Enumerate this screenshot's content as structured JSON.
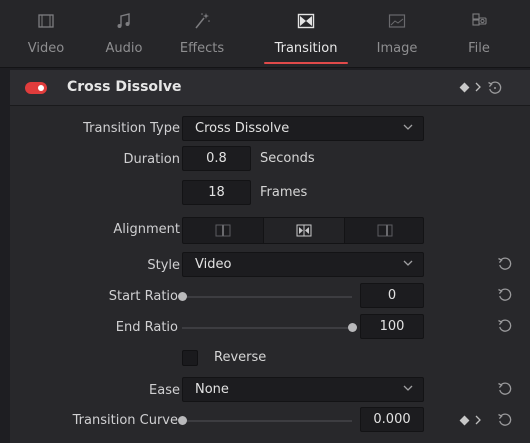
{
  "tabs": [
    {
      "label": "Video",
      "icon": "film-icon",
      "active": false
    },
    {
      "label": "Audio",
      "icon": "music-note-icon",
      "active": false
    },
    {
      "label": "Effects",
      "icon": "magic-wand-icon",
      "active": false
    },
    {
      "label": "Transition",
      "icon": "transition-icon",
      "active": true
    },
    {
      "label": "Image",
      "icon": "image-icon",
      "active": false
    },
    {
      "label": "File",
      "icon": "file-metadata-icon",
      "active": false
    }
  ],
  "panel": {
    "title": "Cross Dissolve",
    "enabled": true
  },
  "transition_type": {
    "label": "Transition Type",
    "value": "Cross Dissolve"
  },
  "duration": {
    "label": "Duration",
    "seconds": "0.8",
    "seconds_unit": "Seconds",
    "frames": "18",
    "frames_unit": "Frames"
  },
  "alignment": {
    "label": "Alignment",
    "options": [
      "start-on-edit",
      "center-on-edit",
      "end-on-edit"
    ],
    "selected": "center-on-edit"
  },
  "style": {
    "label": "Style",
    "value": "Video"
  },
  "start_ratio": {
    "label": "Start Ratio",
    "value": "0",
    "fraction": 0
  },
  "end_ratio": {
    "label": "End Ratio",
    "value": "100",
    "fraction": 1
  },
  "reverse": {
    "label": "Reverse",
    "checked": false
  },
  "ease": {
    "label": "Ease",
    "value": "None"
  },
  "transition_curve": {
    "label": "Transition Curve",
    "value": "0.000",
    "fraction": 0
  },
  "colors": {
    "accent": "#e04a4a",
    "panel_bg": "#28282b",
    "field_bg": "#1c1c1f"
  }
}
